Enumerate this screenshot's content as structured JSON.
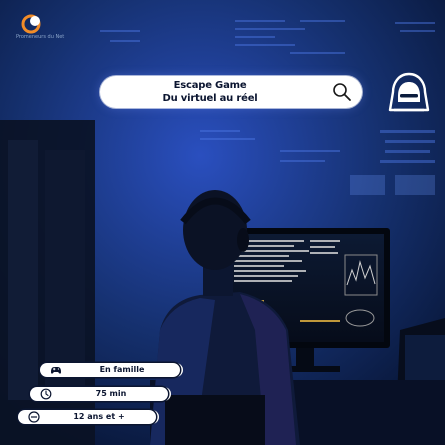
{
  "logo": {
    "name": "Promeneurs du Net"
  },
  "search": {
    "line1": "Escape Game",
    "line2": "Du virtuel au réel"
  },
  "badges": [
    {
      "label": "En famille",
      "icon": "gamepad-icon"
    },
    {
      "label": "75 min",
      "icon": "clock-icon"
    },
    {
      "label": "12 ans et +",
      "icon": "age-rating-icon"
    }
  ],
  "colors": {
    "background": "#0a1b3c",
    "accent_blue": "#3a5bd9",
    "logo_orange": "#f28c28",
    "pill": "#ffffff",
    "text_dark": "#0b1530"
  },
  "icons": {
    "hacker": "hooded-hacker-icon",
    "search": "search-icon"
  }
}
